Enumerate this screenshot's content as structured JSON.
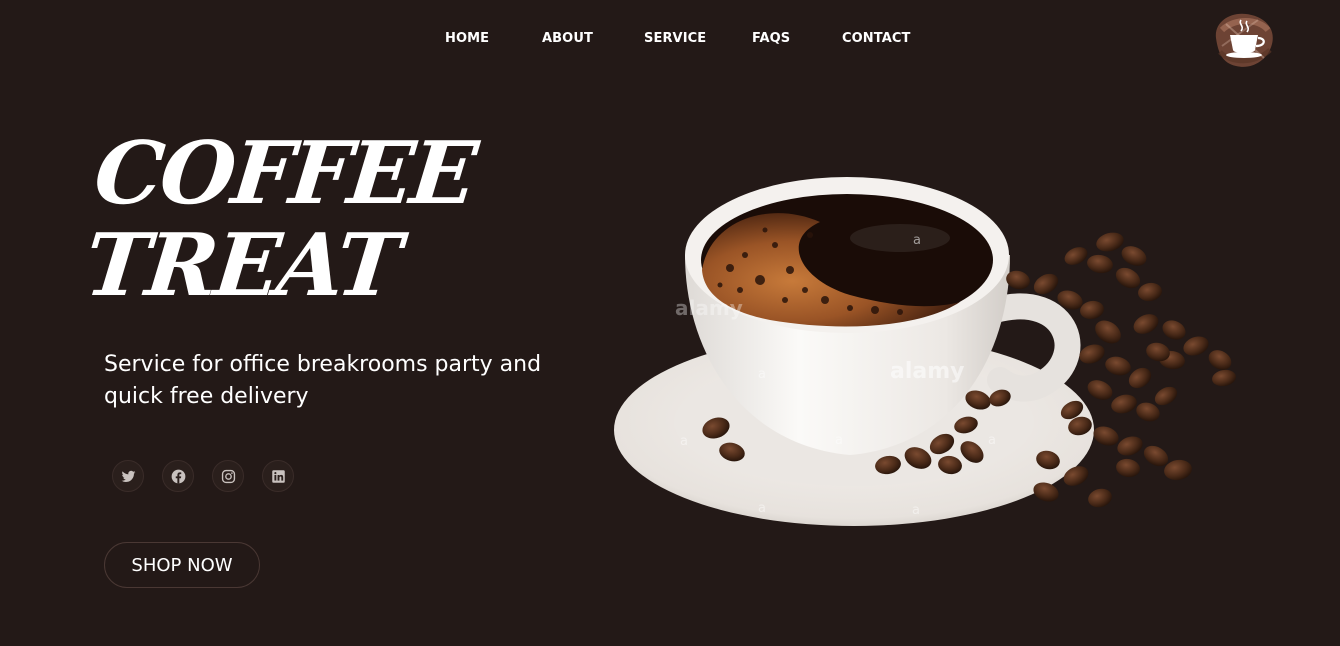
{
  "nav": {
    "items": [
      {
        "label": "HOME"
      },
      {
        "label": "ABOUT"
      },
      {
        "label": "SERVICE"
      },
      {
        "label": "FAQS"
      },
      {
        "label": "CONTACT"
      }
    ]
  },
  "logo": {
    "icon": "coffee-cup-icon"
  },
  "hero": {
    "title_line1": "COFFEE",
    "title_line2": "TREAT",
    "subtitle": "Service for office breakrooms party and quick free delivery",
    "cta_label": "SHOP NOW"
  },
  "social": [
    {
      "icon": "twitter-icon"
    },
    {
      "icon": "facebook-icon"
    },
    {
      "icon": "instagram-icon"
    },
    {
      "icon": "linkedin-icon"
    }
  ],
  "image": {
    "watermark": "alamy",
    "watermark_small": "a"
  },
  "colors": {
    "background": "#231917",
    "text": "#ffffff",
    "icon": "#c9c2bf",
    "button_border": "#4a3834"
  }
}
